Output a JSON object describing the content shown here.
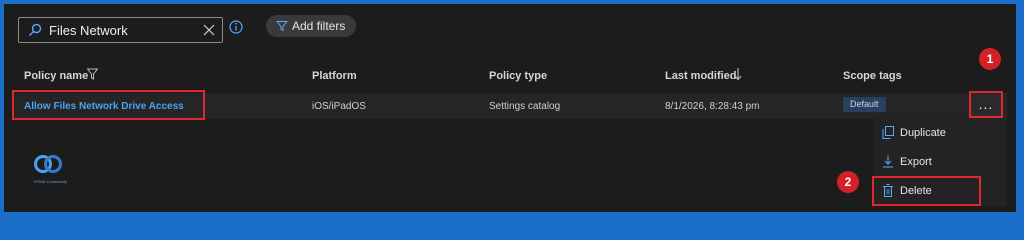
{
  "search": {
    "value": "Files Network",
    "icon": "search-icon",
    "clear_icon": "close-icon"
  },
  "info_icon": "info-icon",
  "filters": {
    "label": "Add filters",
    "icon": "filter-icon"
  },
  "table": {
    "headers": {
      "policy_name": "Policy name",
      "platform": "Platform",
      "policy_type": "Policy type",
      "last_modified": "Last modified",
      "scope_tags": "Scope tags"
    },
    "rows": [
      {
        "policy_name": "Allow Files Network Drive Access",
        "platform": "iOS/iPadOS",
        "policy_type": "Settings catalog",
        "last_modified": "8/1/2026, 8:28:43 pm",
        "scope_tags": "Default",
        "more": "..."
      }
    ]
  },
  "context_menu": {
    "items": [
      {
        "label": "Duplicate",
        "icon": "duplicate-icon"
      },
      {
        "label": "Export",
        "icon": "download-icon"
      },
      {
        "label": "Delete",
        "icon": "trash-icon"
      }
    ]
  },
  "annotations": {
    "step1": "1",
    "step2": "2"
  },
  "logo": {
    "text": "HTMD Community"
  },
  "colors": {
    "accent_link": "#4aa3f0",
    "highlight": "#e0282e",
    "step_badge": "#d32127",
    "frame": "#1b6fc8"
  }
}
